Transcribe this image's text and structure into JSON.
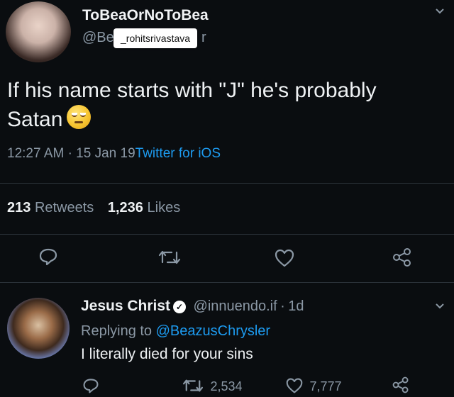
{
  "tweet": {
    "display_name": "ToBeaOrNoToBea",
    "handle_start": "@Be",
    "handle_end": "r",
    "sticker_text": "_rohitsrivastava",
    "text_line1": "If his name starts with \"J\" he's probably",
    "text_line2": "Satan",
    "emoji": "unamused-face",
    "time": "12:27 AM",
    "separator": "·",
    "date": "15 Jan 19",
    "source": "Twitter for iOS",
    "retweets_count": "213",
    "retweets_label": "Retweets",
    "likes_count": "1,236",
    "likes_label": "Likes"
  },
  "actions": {
    "icons": [
      "reply-icon",
      "retweet-icon",
      "like-icon",
      "share-icon"
    ]
  },
  "reply": {
    "display_name": "Jesus Christ",
    "handle": "@innuendo.if",
    "separator": "·",
    "age": "1d",
    "replying_prefix": "Replying to",
    "replying_handle": "@BeazusChrysler",
    "text": "I literally died for your sins",
    "retweet_count": "2,534",
    "like_count": "7,777"
  },
  "colors": {
    "background": "#0a0d10",
    "text": "#eef1f3",
    "muted": "#8b98a5",
    "link": "#1d9bf0"
  }
}
